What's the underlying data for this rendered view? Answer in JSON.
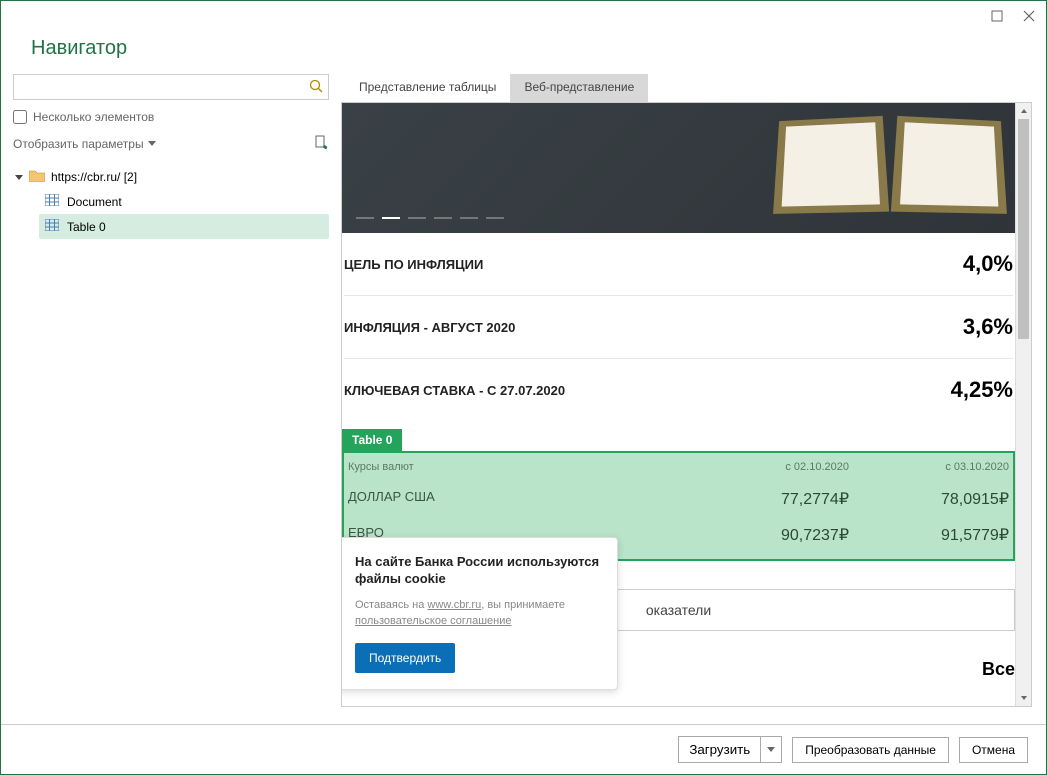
{
  "title": "Навигатор",
  "search_placeholder": "",
  "multi_items_label": "Несколько элементов",
  "display_options_label": "Отобразить параметры",
  "tree": {
    "root_label": "https://cbr.ru/ [2]",
    "items": [
      {
        "label": "Document"
      },
      {
        "label": "Table 0"
      }
    ]
  },
  "tabs": {
    "table_view": "Представление таблицы",
    "web_view": "Веб-представление"
  },
  "info_rows": [
    {
      "label": "ЦЕЛЬ ПО ИНФЛЯЦИИ",
      "value": "4,0%"
    },
    {
      "label": "ИНФЛЯЦИЯ - АВГУСТ 2020",
      "value": "3,6%"
    },
    {
      "label": "КЛЮЧЕВАЯ СТАВКА - С 27.07.2020",
      "value": "4,25%"
    }
  ],
  "table_badge": "Table 0",
  "currency_table": {
    "header_name": "Курсы валют",
    "header_date1": "с 02.10.2020",
    "header_date2": "с 03.10.2020",
    "rows": [
      {
        "name": "ДОЛЛАР США",
        "v1": "77,2774₽",
        "v2": "78,0915₽"
      },
      {
        "name": "ЕВРО",
        "v1": "90,7237₽",
        "v2": "91,5779₽"
      }
    ]
  },
  "all_indicators_label": "оказатели",
  "cookie": {
    "title": "На сайте Банка России используются файлы cookie",
    "text_prefix": "Оставаясь на ",
    "link1": "www.cbr.ru",
    "text_mid": ", вы принимаете ",
    "link2": "пользовательское соглашение",
    "confirm": "Подтвердить"
  },
  "news_all": "Все",
  "footer": {
    "load": "Загрузить",
    "transform": "Преобразовать данные",
    "cancel": "Отмена"
  }
}
